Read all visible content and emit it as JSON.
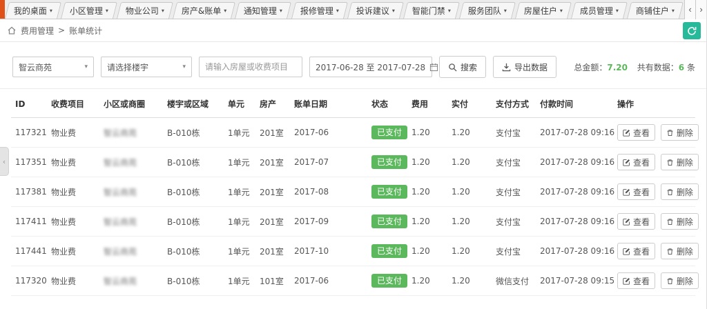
{
  "tabs": [
    {
      "label": "我的桌面"
    },
    {
      "label": "小区管理"
    },
    {
      "label": "物业公司"
    },
    {
      "label": "房产&账单"
    },
    {
      "label": "通知管理"
    },
    {
      "label": "报修管理"
    },
    {
      "label": "投诉建议"
    },
    {
      "label": "智能门禁"
    },
    {
      "label": "服务团队"
    },
    {
      "label": "房屋住户"
    },
    {
      "label": "成员管理"
    },
    {
      "label": "商铺住户"
    }
  ],
  "tab_nav": {
    "prev": "‹",
    "next": "›"
  },
  "breadcrumb": {
    "section": "费用管理",
    "separator": ">",
    "page": "账单统计"
  },
  "filters": {
    "community": {
      "value": "智云商苑"
    },
    "building": {
      "value": "请选择楼宇"
    },
    "keyword": {
      "placeholder": "请输入房屋或收费项目",
      "value": ""
    },
    "date_range": {
      "value": "2017-06-28 至 2017-07-28"
    },
    "search_button": "搜索",
    "export_button": "导出数据"
  },
  "summary": {
    "total_label": "总金额：",
    "total_value": "7.20",
    "count_label": "共有数据：",
    "count_value": "6",
    "count_unit": "条"
  },
  "table": {
    "headers": [
      "ID",
      "收费项目",
      "小区或商圈",
      "楼宇或区域",
      "单元",
      "房产",
      "账单日期",
      "状态",
      "费用",
      "实付",
      "支付方式",
      "付款时间",
      "操作"
    ],
    "actions": {
      "view": "查看",
      "delete": "删除"
    },
    "rows": [
      {
        "id": "117321",
        "item": "物业费",
        "community": "智云商苑",
        "building": "B-010栋",
        "unit": "1单元",
        "room": "201室",
        "bill_date": "2017-06",
        "status": "已支付",
        "fee": "1.20",
        "paid": "1.20",
        "pay_method": "支付宝",
        "pay_time": "2017-07-28 09:16"
      },
      {
        "id": "117351",
        "item": "物业费",
        "community": "智云商苑",
        "building": "B-010栋",
        "unit": "1单元",
        "room": "201室",
        "bill_date": "2017-07",
        "status": "已支付",
        "fee": "1.20",
        "paid": "1.20",
        "pay_method": "支付宝",
        "pay_time": "2017-07-28 09:16"
      },
      {
        "id": "117381",
        "item": "物业费",
        "community": "智云商苑",
        "building": "B-010栋",
        "unit": "1单元",
        "room": "201室",
        "bill_date": "2017-08",
        "status": "已支付",
        "fee": "1.20",
        "paid": "1.20",
        "pay_method": "支付宝",
        "pay_time": "2017-07-28 09:16"
      },
      {
        "id": "117411",
        "item": "物业费",
        "community": "智云商苑",
        "building": "B-010栋",
        "unit": "1单元",
        "room": "201室",
        "bill_date": "2017-09",
        "status": "已支付",
        "fee": "1.20",
        "paid": "1.20",
        "pay_method": "支付宝",
        "pay_time": "2017-07-28 09:16"
      },
      {
        "id": "117441",
        "item": "物业费",
        "community": "智云商苑",
        "building": "B-010栋",
        "unit": "1单元",
        "room": "201室",
        "bill_date": "2017-10",
        "status": "已支付",
        "fee": "1.20",
        "paid": "1.20",
        "pay_method": "支付宝",
        "pay_time": "2017-07-28 09:16"
      },
      {
        "id": "117320",
        "item": "物业费",
        "community": "智云商苑",
        "building": "B-010栋",
        "unit": "1单元",
        "room": "101室",
        "bill_date": "2017-06",
        "status": "已支付",
        "fee": "1.20",
        "paid": "1.20",
        "pay_method": "微信支付",
        "pay_time": "2017-07-28 09:15"
      }
    ]
  },
  "icons": {
    "caret_down": "▾",
    "chevron_left": "‹",
    "chevron_right": "›",
    "collapse_left": "‹"
  },
  "colors": {
    "accent_green": "#26b99a",
    "success_green": "#5cb85c",
    "active_tab_stripe": "#e0511a"
  }
}
